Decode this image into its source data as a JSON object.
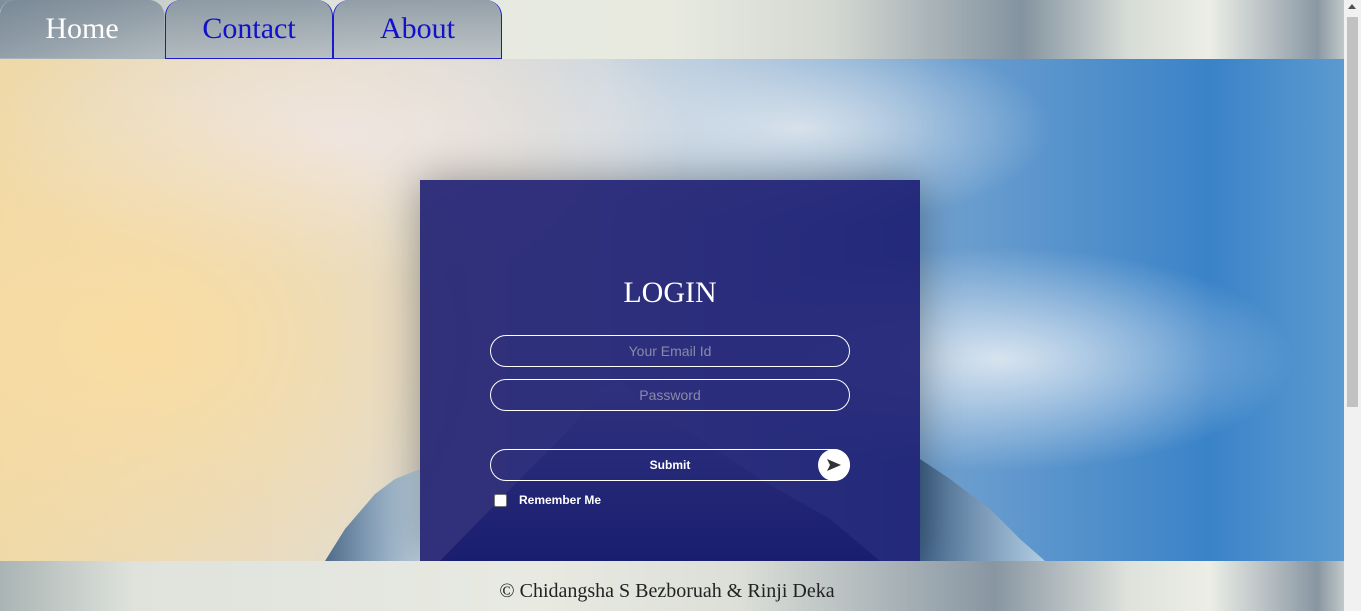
{
  "nav": {
    "tabs": [
      {
        "label": "Home"
      },
      {
        "label": "Contact"
      },
      {
        "label": "About"
      }
    ]
  },
  "login": {
    "title": "LOGIN",
    "email_placeholder": "Your Email Id",
    "password_placeholder": "Password",
    "submit_label": "Submit",
    "remember_label": "Remember Me",
    "remember_checked": false
  },
  "footer": {
    "text": "© Chidangsha S Bezboruah & Rinji Deka"
  },
  "icons": {
    "submit": "send-arrow-icon"
  },
  "colors": {
    "panel": "#18186e",
    "link": "#1111cc",
    "white": "#ffffff"
  }
}
